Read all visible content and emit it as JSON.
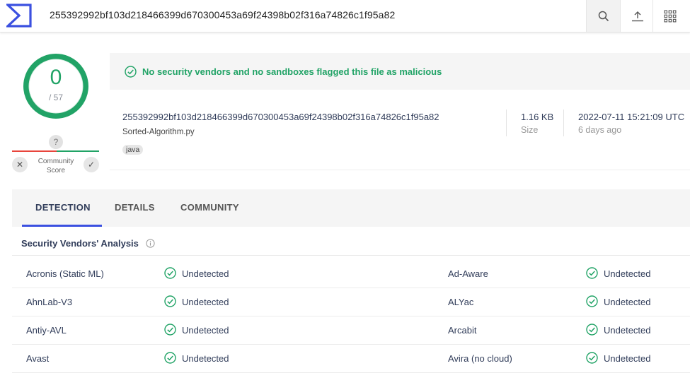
{
  "header": {
    "search_value": "255392992bf103d218466399d670300453a69f24398b02f316a74826c1f95a82",
    "icons": [
      "logo-icon",
      "search-icon",
      "upload-icon",
      "apps-grid-icon"
    ]
  },
  "score": {
    "detections": "0",
    "total": "/ 57",
    "community_question": "?",
    "community_label_1": "Community",
    "community_label_2": "Score",
    "negative_symbol": "✕",
    "positive_symbol": "✓"
  },
  "summary": {
    "banner": "No security vendors and no sandboxes flagged this file as malicious",
    "hash": "255392992bf103d218466399d670300453a69f24398b02f316a74826c1f95a82",
    "file_name": "Sorted-Algorithm.py",
    "tag": "java",
    "size_value": "1.16 KB",
    "size_label": "Size",
    "date_value": "2022-07-11 15:21:09 UTC",
    "date_ago": "6 days ago"
  },
  "tabs": [
    {
      "label": "DETECTION"
    },
    {
      "label": "DETAILS"
    },
    {
      "label": "COMMUNITY"
    }
  ],
  "analysis": {
    "title": "Security Vendors' Analysis",
    "rows": [
      {
        "left_vendor": "Acronis (Static ML)",
        "left_status": "Undetected",
        "right_vendor": "Ad-Aware",
        "right_status": "Undetected"
      },
      {
        "left_vendor": "AhnLab-V3",
        "left_status": "Undetected",
        "right_vendor": "ALYac",
        "right_status": "Undetected"
      },
      {
        "left_vendor": "Antiy-AVL",
        "left_status": "Undetected",
        "right_vendor": "Arcabit",
        "right_status": "Undetected"
      },
      {
        "left_vendor": "Avast",
        "left_status": "Undetected",
        "right_vendor": "Avira (no cloud)",
        "right_status": "Undetected"
      }
    ]
  },
  "colors": {
    "accent": "#3b50e0",
    "clean": "#21a366",
    "negative": "#e8453c"
  }
}
